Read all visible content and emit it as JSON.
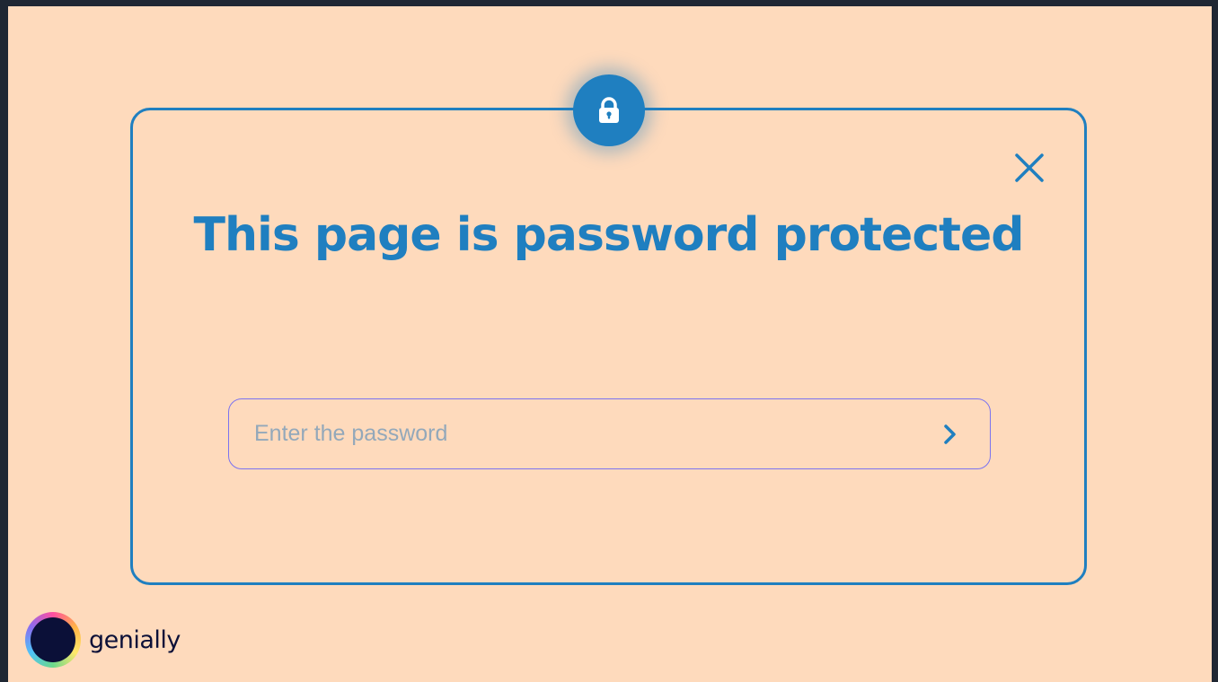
{
  "dialog": {
    "title": "This page is password protected",
    "lock_icon": "lock-icon",
    "close_icon": "close-icon",
    "accent_color": "#1f7fc0"
  },
  "password_field": {
    "placeholder": "Enter the password",
    "value": "",
    "submit_icon": "chevron-right-icon",
    "border_color": "#7b73f0"
  },
  "brand": {
    "name": "genially",
    "logo_icon": "genially-logo-icon"
  },
  "background_color": "#fedabc"
}
